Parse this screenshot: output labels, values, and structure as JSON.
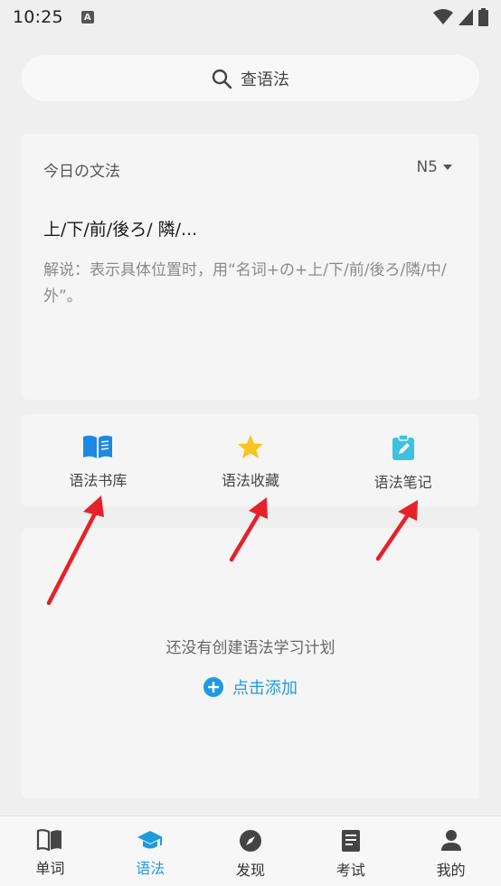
{
  "status_bar": {
    "time": "10:25",
    "notification_icon": "A"
  },
  "search": {
    "placeholder": "查语法"
  },
  "today_card": {
    "title": "今日の文法",
    "level": "N5",
    "grammar_title": "上/下/前/後ろ/ 隣/...",
    "grammar_desc": "解说：表示具体位置时，用“名词+の+上/下/前/後ろ/隣/中/外”。"
  },
  "actions": [
    {
      "label": "语法书库",
      "icon": "book-icon",
      "color": "#1e88e5"
    },
    {
      "label": "语法收藏",
      "icon": "star-icon",
      "color": "#f7c51e"
    },
    {
      "label": "语法笔记",
      "icon": "clipboard-edit-icon",
      "color": "#3cc2e0"
    }
  ],
  "plan": {
    "empty_text": "还没有创建语法学习计划",
    "add_label": "点击添加"
  },
  "bottom_nav": [
    {
      "label": "单词",
      "icon": "book-open-icon",
      "active": false
    },
    {
      "label": "语法",
      "icon": "graduation-cap-icon",
      "active": true
    },
    {
      "label": "发现",
      "icon": "compass-icon",
      "active": false
    },
    {
      "label": "考试",
      "icon": "exam-book-icon",
      "active": false
    },
    {
      "label": "我的",
      "icon": "person-icon",
      "active": false
    }
  ],
  "accent_color": "#1e9be0",
  "arrow_color": "#e8202a"
}
